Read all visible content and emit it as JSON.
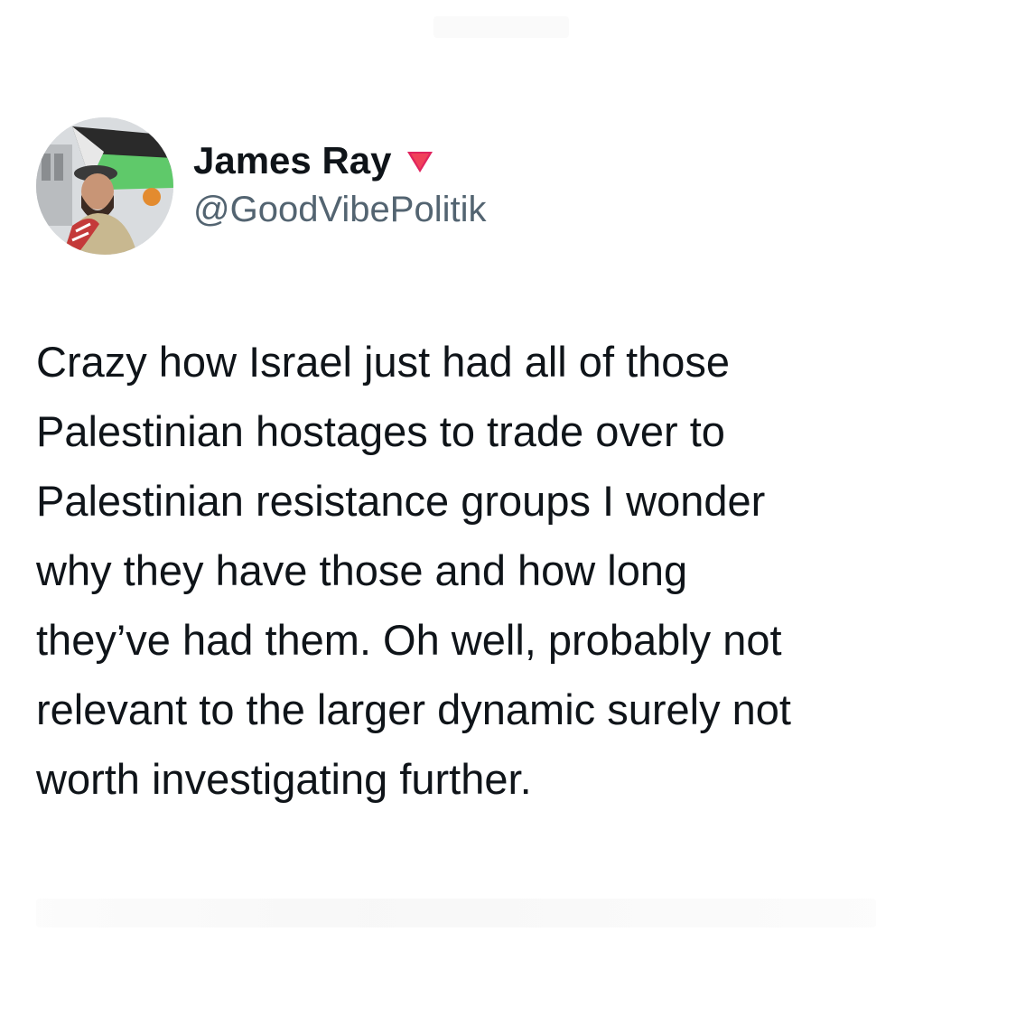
{
  "author": {
    "display_name": "James Ray",
    "handle": "@GoodVibePolitik",
    "flag_icon": "red-triangle-icon",
    "avatar_icon": "profile-photo"
  },
  "tweet": {
    "lines": [
      "Crazy how Israel just had all of those",
      "Palestinian hostages to trade over to",
      "Palestinian resistance groups I wonder",
      "why they have those and how long",
      "they’ve had them. Oh well, probably not",
      "relevant to the larger dynamic surely not",
      "worth investigating further."
    ]
  },
  "colors": {
    "name": "#0f1419",
    "handle": "#536471",
    "flag": "#e0245e",
    "background": "#ffffff"
  }
}
